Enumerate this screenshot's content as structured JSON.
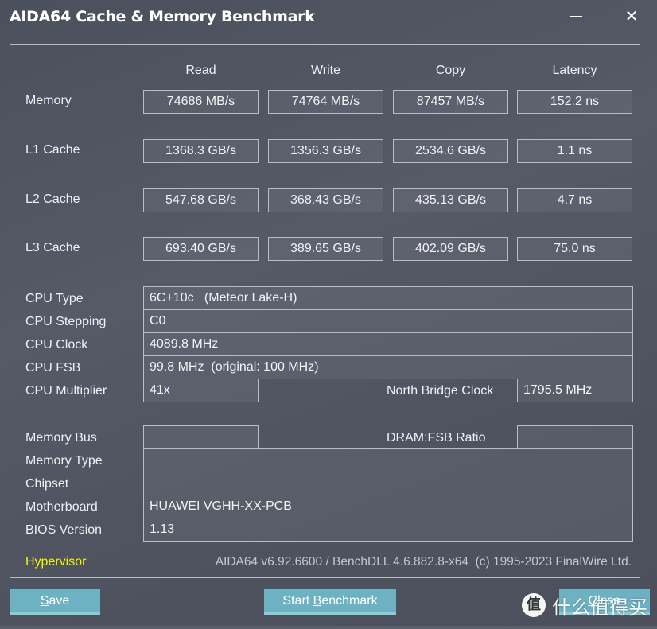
{
  "window": {
    "title": "AIDA64 Cache & Memory Benchmark",
    "minimize_glyph": "",
    "close_glyph": "✕"
  },
  "benchmark": {
    "columns": [
      "Read",
      "Write",
      "Copy",
      "Latency"
    ],
    "rows": [
      {
        "label": "Memory",
        "read": "74686 MB/s",
        "write": "74764 MB/s",
        "copy": "87457 MB/s",
        "latency": "152.2 ns"
      },
      {
        "label": "L1 Cache",
        "read": "1368.3 GB/s",
        "write": "1356.3 GB/s",
        "copy": "2534.6 GB/s",
        "latency": "1.1 ns"
      },
      {
        "label": "L2 Cache",
        "read": "547.68 GB/s",
        "write": "368.43 GB/s",
        "copy": "435.13 GB/s",
        "latency": "4.7 ns"
      },
      {
        "label": "L3 Cache",
        "read": "693.40 GB/s",
        "write": "389.65 GB/s",
        "copy": "402.09 GB/s",
        "latency": "75.0 ns"
      }
    ]
  },
  "cpu_info": {
    "cpu_type": {
      "label": "CPU Type",
      "value": "6C+10c   (Meteor Lake-H)"
    },
    "cpu_stepping": {
      "label": "CPU Stepping",
      "value": "C0"
    },
    "cpu_clock": {
      "label": "CPU Clock",
      "value": "4089.8 MHz"
    },
    "cpu_fsb": {
      "label": "CPU FSB",
      "value": "99.8 MHz  (original: 100 MHz)"
    },
    "cpu_multiplier": {
      "label": "CPU Multiplier",
      "value": "41x"
    },
    "north_bridge_clock": {
      "label": "North Bridge Clock",
      "value": "1795.5 MHz"
    }
  },
  "system_info": {
    "memory_bus": {
      "label": "Memory Bus",
      "value": ""
    },
    "dram_fsb_ratio": {
      "label": "DRAM:FSB Ratio",
      "value": ""
    },
    "memory_type": {
      "label": "Memory Type",
      "value": ""
    },
    "chipset": {
      "label": "Chipset",
      "value": ""
    },
    "motherboard": {
      "label": "Motherboard",
      "value": "HUAWEI VGHH-XX-PCB"
    },
    "bios_version": {
      "label": "BIOS Version",
      "value": "1.13"
    }
  },
  "footer": {
    "hypervisor_link": "Hypervisor",
    "version_text": "AIDA64 v6.92.6600 / BenchDLL 4.6.882.8-x64  (c) 1995-2023 FinalWire Ltd.",
    "hypervisor_color": "#f5f500"
  },
  "buttons": {
    "save": {
      "accel": "S",
      "rest": "ave"
    },
    "start": {
      "pre": "Start ",
      "accel": "B",
      "rest": "enchmark"
    },
    "close": {
      "accel": "C",
      "rest": "lose"
    }
  },
  "watermark": {
    "icon_glyph": "值",
    "text": "什么值得买"
  },
  "colors": {
    "button_bg": "#6db2c2",
    "background": "#4e535f",
    "border": "#b9bdc5"
  }
}
